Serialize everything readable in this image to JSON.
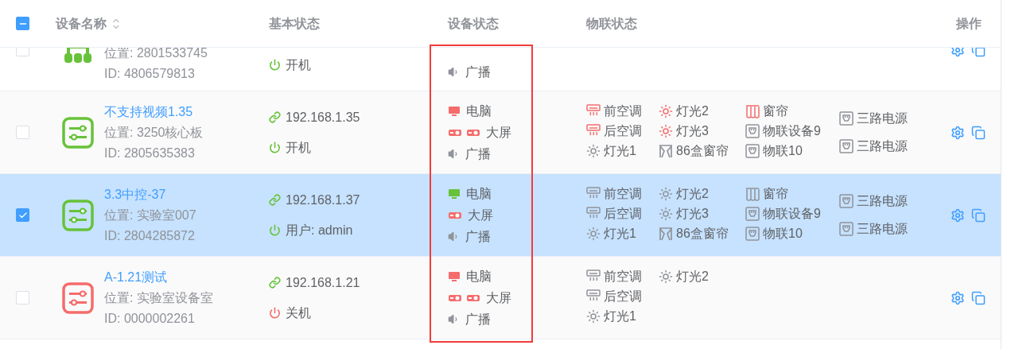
{
  "header": {
    "checkbox": {
      "indeterminate": true
    },
    "columns": [
      {
        "label": "设备名称",
        "sortable": true
      },
      {
        "label": "基本状态"
      },
      {
        "label": "设备状态"
      },
      {
        "label": "物联状态"
      },
      {
        "label": "操作"
      }
    ]
  },
  "rows": [
    {
      "selected": false,
      "kind": "hub",
      "online": true,
      "location": "位置: 2801533745",
      "id": "ID: 4806579813",
      "power": {
        "on": true,
        "label": "开机"
      },
      "device_status": [
        {
          "label": "广播",
          "icons": [
            {
              "kind": "speaker"
            }
          ]
        }
      ]
    },
    {
      "selected": false,
      "kind": "panel",
      "online": true,
      "name": "不支持视频1.35",
      "location": "位置: 3250核心板",
      "id": "ID: 2805635383",
      "ip": "192.168.1.35",
      "power": {
        "on": true,
        "label": "开机"
      },
      "device_status": [
        {
          "label": "电脑",
          "icons": [
            {
              "kind": "monitor",
              "on": false
            }
          ]
        },
        {
          "label": "大屏",
          "icons": [
            {
              "kind": "projector",
              "on": false
            },
            {
              "kind": "projector",
              "on": false
            }
          ]
        },
        {
          "label": "广播",
          "icons": [
            {
              "kind": "speaker"
            }
          ]
        }
      ],
      "iot_columns": [
        [
          {
            "kind": "ac",
            "on": true,
            "label": "前空调"
          },
          {
            "kind": "ac",
            "on": true,
            "label": "后空调"
          },
          {
            "kind": "light",
            "on": false,
            "label": "灯光1"
          }
        ],
        [
          {
            "kind": "light",
            "on": true,
            "label": "灯光2"
          },
          {
            "kind": "light",
            "on": true,
            "label": "灯光3"
          },
          {
            "kind": "box-curtain",
            "on": false,
            "label": "86盒窗帘"
          }
        ],
        [
          {
            "kind": "curtain",
            "on": true,
            "label": "窗帘"
          },
          {
            "kind": "socket",
            "on": false,
            "label": "物联设备9"
          },
          {
            "kind": "socket",
            "on": false,
            "label": "物联10"
          }
        ],
        [
          {
            "kind": "socket",
            "on": false,
            "label": "三路电源"
          },
          {
            "kind": "socket",
            "on": false,
            "label": "三路电源"
          }
        ]
      ]
    },
    {
      "selected": true,
      "kind": "panel",
      "online": true,
      "name": "3.3中控-37",
      "location": "位置: 实验室007",
      "id": "ID: 2804285872",
      "ip": "192.168.1.37",
      "power": {
        "on": true,
        "label": "用户: admin"
      },
      "device_status": [
        {
          "label": "电脑",
          "icons": [
            {
              "kind": "monitor",
              "on": true
            }
          ]
        },
        {
          "label": "大屏",
          "icons": [
            {
              "kind": "projector",
              "on": false
            }
          ]
        },
        {
          "label": "广播",
          "icons": [
            {
              "kind": "speaker"
            }
          ]
        }
      ],
      "iot_columns": [
        [
          {
            "kind": "ac",
            "on": false,
            "label": "前空调"
          },
          {
            "kind": "ac",
            "on": false,
            "label": "后空调"
          },
          {
            "kind": "light",
            "on": false,
            "label": "灯光1"
          }
        ],
        [
          {
            "kind": "light",
            "on": false,
            "label": "灯光2"
          },
          {
            "kind": "light",
            "on": false,
            "label": "灯光3"
          },
          {
            "kind": "box-curtain",
            "on": false,
            "label": "86盒窗帘"
          }
        ],
        [
          {
            "kind": "curtain",
            "on": false,
            "label": "窗帘"
          },
          {
            "kind": "socket",
            "on": false,
            "label": "物联设备9"
          },
          {
            "kind": "socket",
            "on": false,
            "label": "物联10"
          }
        ],
        [
          {
            "kind": "socket",
            "on": false,
            "label": "三路电源"
          },
          {
            "kind": "socket",
            "on": false,
            "label": "三路电源"
          }
        ]
      ]
    },
    {
      "selected": false,
      "kind": "panel",
      "online": false,
      "name": "A-1.21测试",
      "location": "位置: 实验室设备室",
      "id": "ID: 0000002261",
      "ip": "192.168.1.21",
      "power": {
        "on": false,
        "label": "关机"
      },
      "device_status": [
        {
          "label": "电脑",
          "icons": [
            {
              "kind": "monitor",
              "on": false
            }
          ]
        },
        {
          "label": "大屏",
          "icons": [
            {
              "kind": "projector",
              "on": false
            },
            {
              "kind": "projector",
              "on": false
            }
          ]
        },
        {
          "label": "广播",
          "icons": [
            {
              "kind": "speaker"
            }
          ]
        }
      ],
      "iot_columns": [
        [
          {
            "kind": "ac",
            "on": false,
            "label": "前空调"
          },
          {
            "kind": "ac",
            "on": false,
            "label": "后空调"
          },
          {
            "kind": "light",
            "on": false,
            "label": "灯光1"
          }
        ],
        [
          {
            "kind": "light",
            "on": false,
            "label": "灯光2"
          }
        ]
      ]
    }
  ]
}
